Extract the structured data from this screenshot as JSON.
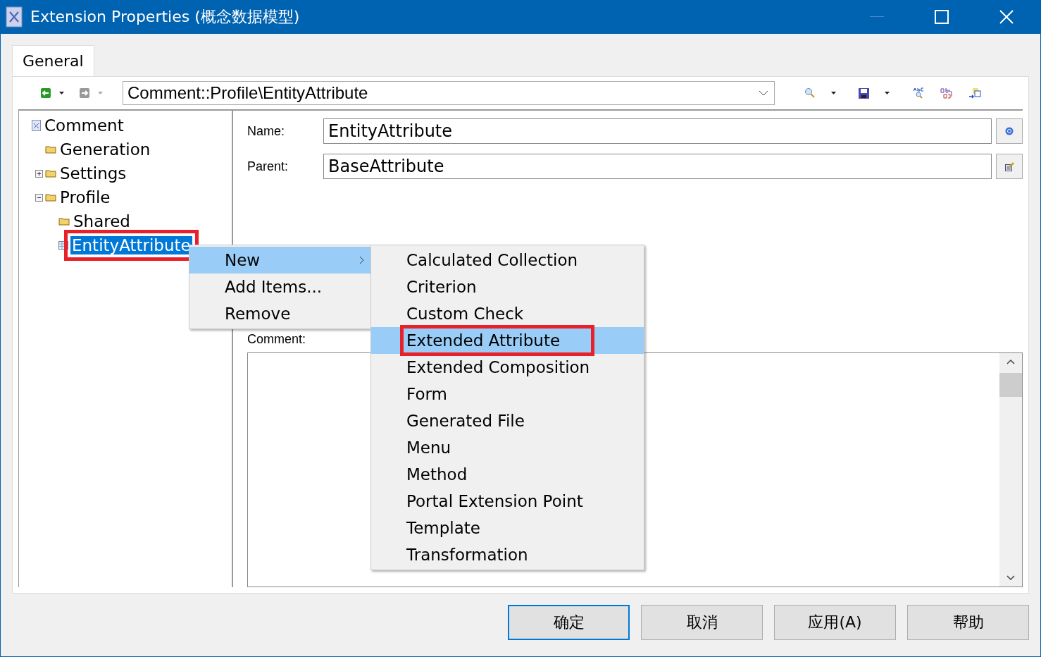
{
  "window": {
    "title": "Extension Properties (概念数据模型)"
  },
  "tabs": [
    {
      "label": "General",
      "selected": true
    }
  ],
  "path_combo": {
    "value": "Comment::Profile\\EntityAttribute"
  },
  "tree": [
    {
      "label": "Comment",
      "kind": "document",
      "selected": false,
      "highlighted": false,
      "children": [
        {
          "label": "Generation",
          "kind": "folder",
          "selected": false,
          "highlighted": false
        },
        {
          "label": "Settings",
          "kind": "folder",
          "expanded": false,
          "selected": false,
          "highlighted": false
        },
        {
          "label": "Profile",
          "kind": "folder",
          "expanded": true,
          "selected": false,
          "highlighted": false,
          "children": [
            {
              "label": "Shared",
              "kind": "folder",
              "selected": false,
              "highlighted": false
            },
            {
              "label": "EntityAttribute",
              "kind": "table",
              "selected": true,
              "highlighted": true
            }
          ]
        }
      ]
    }
  ],
  "fields": [
    {
      "label": "Name:",
      "value": "EntityAttribute"
    },
    {
      "label": "Parent:",
      "value": "BaseAttribute"
    }
  ],
  "comment": {
    "label": "Comment:"
  },
  "context_menu": [
    {
      "label": "New",
      "has_submenu": true,
      "selected": true
    },
    {
      "label": "Add Items...",
      "has_submenu": false,
      "selected": false
    },
    {
      "label": "Remove",
      "has_submenu": false,
      "selected": false
    }
  ],
  "submenu": [
    {
      "label": "Calculated Collection",
      "selected": false,
      "highlighted": false
    },
    {
      "label": "Criterion",
      "selected": false,
      "highlighted": false
    },
    {
      "label": "Custom Check",
      "selected": false,
      "highlighted": false
    },
    {
      "label": "Extended Attribute",
      "selected": true,
      "highlighted": true
    },
    {
      "label": "Extended Composition",
      "selected": false,
      "highlighted": false
    },
    {
      "label": "Form",
      "selected": false,
      "highlighted": false
    },
    {
      "label": "Generated File",
      "selected": false,
      "highlighted": false
    },
    {
      "label": "Menu",
      "selected": false,
      "highlighted": false
    },
    {
      "label": "Method",
      "selected": false,
      "highlighted": false
    },
    {
      "label": "Portal Extension Point",
      "selected": false,
      "highlighted": false
    },
    {
      "label": "Template",
      "selected": false,
      "highlighted": false
    },
    {
      "label": "Transformation",
      "selected": false,
      "highlighted": false
    }
  ],
  "buttons": [
    {
      "label": "确定",
      "default": true
    },
    {
      "label": "取消",
      "default": false
    },
    {
      "label": "应用(A)",
      "default": false
    },
    {
      "label": "帮助",
      "default": false
    }
  ]
}
